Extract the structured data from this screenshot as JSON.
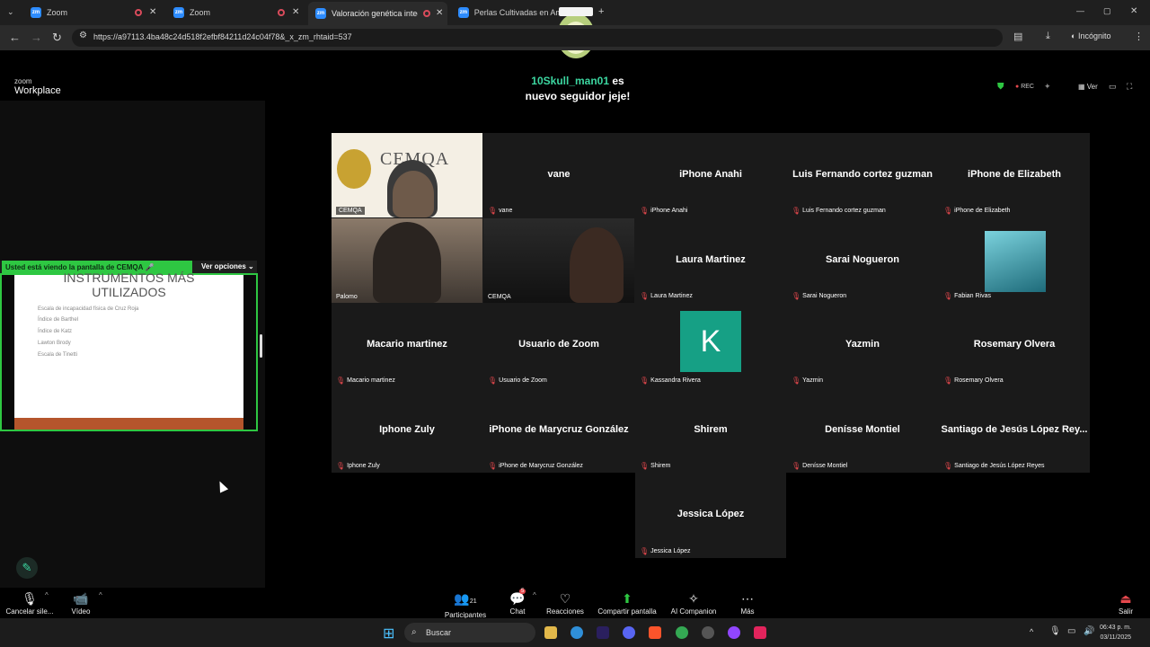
{
  "browser": {
    "tabs": [
      {
        "title": "Zoom"
      },
      {
        "title": "Zoom"
      },
      {
        "title": "Valoración genética integra"
      },
      {
        "title": "Perlas Cultivadas en Amor"
      }
    ],
    "url": "https://a97113.4ba48c24d518f2efbf84211d24c04f78&_x_zm_rhtaid=537",
    "incognito_label": "Incógnito"
  },
  "zoom": {
    "brand_top": "zoom",
    "brand_bottom": "Workplace",
    "notification_user": "10Skull_man01",
    "notification_rest1": " es",
    "notification_rest2": "nuevo seguidor jeje!",
    "rec_label": "REC",
    "view_label": "Ver",
    "viewing_label": "Usted está viendo la pantalla de",
    "viewing_host": "CEMQA",
    "view_options": "Ver opciones",
    "slide": {
      "title_line1": "INSTRUMENTOS MÁS",
      "title_line2": "UTILIZADOS",
      "items": [
        "Escala de incapacidad física de Cruz Roja",
        "Índice de Barthel",
        "Índice de Katz",
        "Lawton Brody",
        "Escala de Tinetti"
      ]
    },
    "participants": [
      {
        "name": "",
        "label": "CEMQA",
        "kind": "cemqa"
      },
      {
        "name": "vane",
        "label": "vane"
      },
      {
        "name": "iPhone Anahi",
        "label": "iPhone Anahi"
      },
      {
        "name": "Luis Fernando cortez guzman",
        "label": "Luis Fernando cortez guzman"
      },
      {
        "name": "iPhone de Elizabeth",
        "label": "iPhone de Elizabeth"
      },
      {
        "name": "",
        "label": "Palomo",
        "kind": "video1"
      },
      {
        "name": "",
        "label": "CEMQA",
        "kind": "video2"
      },
      {
        "name": "Laura Martinez",
        "label": "Laura Martinez"
      },
      {
        "name": "Sarai Nogueron",
        "label": "Sarai Nogueron"
      },
      {
        "name": "",
        "label": "Fabian Rivas",
        "kind": "photo"
      },
      {
        "name": "Macario martinez",
        "label": "Macario martinez"
      },
      {
        "name": "Usuario de Zoom",
        "label": "Usuario de Zoom"
      },
      {
        "name": "K",
        "label": "Kassandra Rivera",
        "kind": "avatar"
      },
      {
        "name": "Yazmin",
        "label": "Yazmin"
      },
      {
        "name": "Rosemary Olvera",
        "label": "Rosemary Olvera"
      },
      {
        "name": "Iphone Zuly",
        "label": "Iphone Zuly"
      },
      {
        "name": "iPhone de Marycruz González",
        "label": "iPhone de Marycruz González"
      },
      {
        "name": "Shirem",
        "label": "Shirem"
      },
      {
        "name": "Denísse Montiel",
        "label": "Denísse Montiel"
      },
      {
        "name": "Santiago de Jesús López Rey...",
        "label": "Santiago de Jesús López Reyes"
      }
    ],
    "last_participant": {
      "name": "Jessica López",
      "label": "Jessica López"
    },
    "toolbar": {
      "mute": "Cancelar sile...",
      "video": "Vídeo",
      "participants": "Participantes",
      "participants_count": "21",
      "chat": "Chat",
      "chat_badge": "5",
      "reactions": "Reacciones",
      "share": "Compartir pantalla",
      "ai": "AI Companion",
      "more": "Más",
      "leave": "Salir"
    }
  },
  "taskbar": {
    "search": "Buscar",
    "time": "06:43 p. m.",
    "date": "03/11/2025"
  },
  "colors": {
    "share_green": "#2ec742",
    "tile_bg": "#1a1a1a",
    "mute_red": "#e5484d",
    "brand_teal": "#3cd6a0"
  }
}
